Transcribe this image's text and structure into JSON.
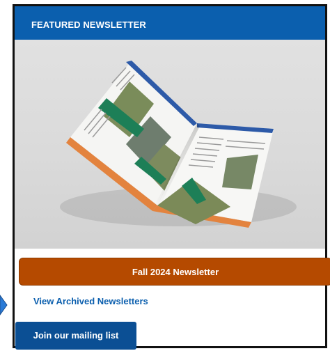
{
  "featured": {
    "title": "FEATURED NEWSLETTER",
    "image_alt": "newsletter-magazine-spread"
  },
  "issue_button": {
    "label": "Fall 2024 Newsletter"
  },
  "archive_link": {
    "label": "View Archived Newsletters"
  },
  "join_button": {
    "label": "Join our mailing list"
  },
  "colors": {
    "header_blue": "#0b5fae",
    "issue_orange": "#b54a00",
    "join_blue": "#0b4f94",
    "arrow_blue": "#2a7ad6"
  }
}
